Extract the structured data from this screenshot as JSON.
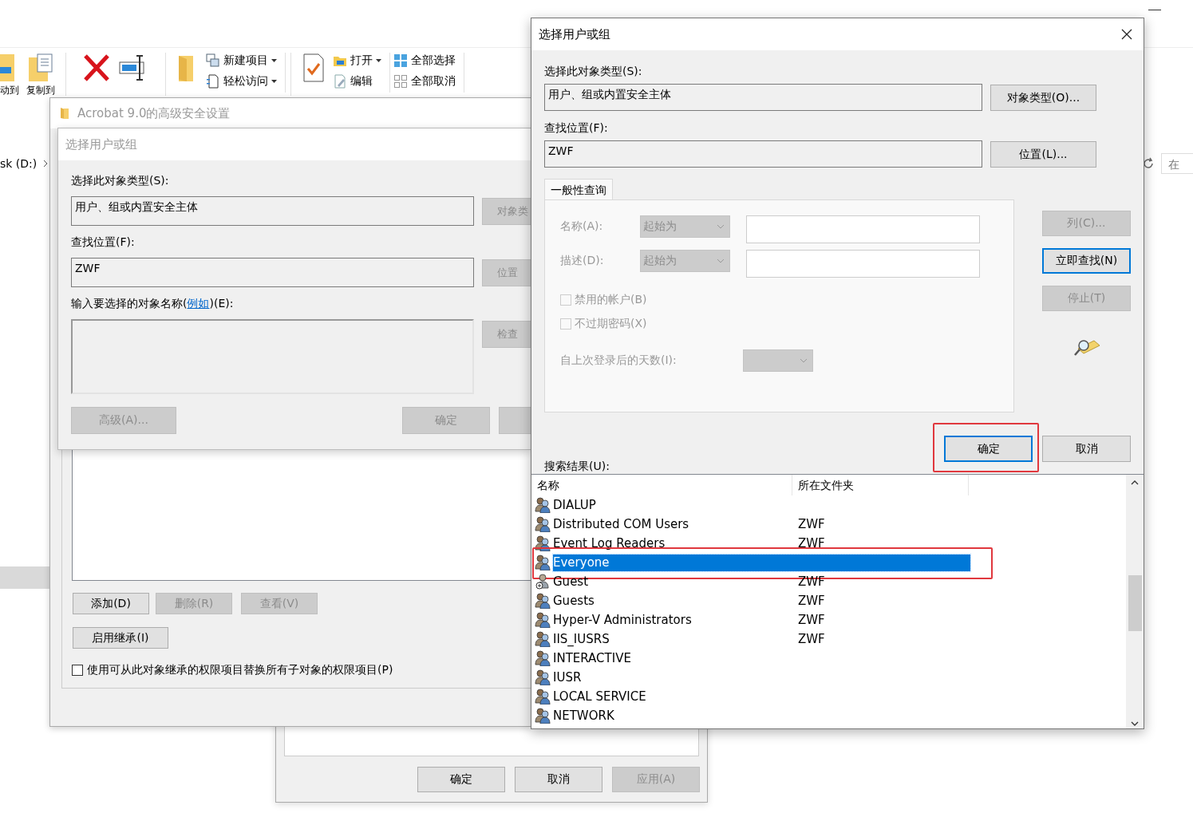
{
  "explorer": {
    "ribbon": [
      {
        "kind": "move",
        "label": "动到"
      },
      {
        "kind": "copy",
        "label": "复制到"
      },
      {
        "kind": "delete"
      },
      {
        "kind": "rename"
      },
      {
        "kind": "new-folder"
      },
      {
        "kind": "small",
        "items": [
          {
            "kind": "new-item",
            "label": "新建项目",
            "menu": true
          },
          {
            "kind": "easy-access",
            "label": "轻松访问",
            "menu": true
          }
        ]
      },
      {
        "kind": "properties"
      },
      {
        "kind": "small",
        "items": [
          {
            "kind": "open",
            "label": "打开",
            "menu": true
          },
          {
            "kind": "edit",
            "label": "编辑",
            "menu": false
          }
        ]
      },
      {
        "kind": "small",
        "items": [
          {
            "kind": "select-all",
            "label": "全部选择",
            "menu": false
          },
          {
            "kind": "select-none",
            "label": "全部取消",
            "menu": false
          }
        ]
      }
    ],
    "address": "sk (D:)",
    "search_placeholder": "在"
  },
  "properties_window": {
    "title": "Acrobat 9.0的高级安全设置",
    "buttons": [
      {
        "label": "添加(D)",
        "disabled": false
      },
      {
        "label": "删除(R)",
        "disabled": true
      },
      {
        "label": "查看(V)",
        "disabled": true
      }
    ],
    "inherit_button": "启用继承(I)",
    "replace_checkbox": {
      "label": "使用可从此对象继承的权限项目替换所有子对象的权限项目(P)",
      "checked": false
    }
  },
  "back_dialog": {
    "title": "选择用户或组",
    "object_type_label": "选择此对象类型(S):",
    "object_type": "用户、组或内置安全主体",
    "object_type_button": "对象类",
    "location_label": "查找位置(F):",
    "location": "ZWF",
    "location_button": "位置",
    "names_label": "输入要选择的对象名称(",
    "names_link": "例如",
    "names_label_end": ")(E):",
    "check_button": "检查",
    "advanced_button": "高级(A)...",
    "ok_button": "确定"
  },
  "bottom_window": {
    "buttons": [
      {
        "label": "确定",
        "disabled": false
      },
      {
        "label": "取消",
        "disabled": false
      },
      {
        "label": "应用(A)",
        "disabled": true
      }
    ]
  },
  "front_dialog": {
    "title": "选择用户或组",
    "object_type_label": "选择此对象类型(S):",
    "object_type": "用户、组或内置安全主体",
    "object_type_button": "对象类型(O)...",
    "location_label": "查找位置(F):",
    "location": "ZWF",
    "location_button": "位置(L)...",
    "tab": "一般性查询",
    "query_rows": [
      {
        "label": "名称(A):",
        "mode": "起始为"
      },
      {
        "label": "描述(D):",
        "mode": "起始为"
      }
    ],
    "checkboxes": [
      {
        "label": "禁用的帐户(B)",
        "checked": false
      },
      {
        "label": "不过期密码(X)",
        "checked": false
      }
    ],
    "days_label": "自上次登录后的天数(I):",
    "side_buttons": [
      {
        "label": "列(C)...",
        "disabled": true,
        "focused": false
      },
      {
        "label": "立即查找(N)",
        "disabled": false,
        "focused": true
      },
      {
        "label": "停止(T)",
        "disabled": true,
        "focused": false
      }
    ],
    "ok_button": {
      "label": "确定",
      "highlighted": true
    },
    "cancel_button": "取消",
    "results_label": "搜索结果(U):",
    "columns": [
      "名称",
      "所在文件夹"
    ],
    "rows": [
      {
        "name": "DIALUP",
        "kind": "group",
        "selected": false,
        "highlighted": false
      },
      {
        "name": "Distributed COM Users",
        "folder": "ZWF",
        "kind": "group",
        "selected": false,
        "highlighted": false
      },
      {
        "name": "Event Log Readers",
        "folder": "ZWF",
        "kind": "group",
        "selected": false,
        "highlighted": false
      },
      {
        "name": "Everyone",
        "kind": "group",
        "selected": true,
        "highlighted": true
      },
      {
        "name": "Guest",
        "folder": "ZWF",
        "kind": "user",
        "selected": false,
        "highlighted": false
      },
      {
        "name": "Guests",
        "folder": "ZWF",
        "kind": "group",
        "selected": false,
        "highlighted": false
      },
      {
        "name": "Hyper-V Administrators",
        "folder": "ZWF",
        "kind": "group",
        "selected": false,
        "highlighted": false
      },
      {
        "name": "IIS_IUSRS",
        "folder": "ZWF",
        "kind": "group",
        "selected": false,
        "highlighted": false
      },
      {
        "name": "INTERACTIVE",
        "kind": "group",
        "selected": false,
        "highlighted": false
      },
      {
        "name": "IUSR",
        "kind": "group",
        "selected": false,
        "highlighted": false
      },
      {
        "name": "LOCAL SERVICE",
        "kind": "group",
        "selected": false,
        "highlighted": false
      },
      {
        "name": "NETWORK",
        "kind": "group",
        "selected": false,
        "highlighted": false
      }
    ]
  }
}
